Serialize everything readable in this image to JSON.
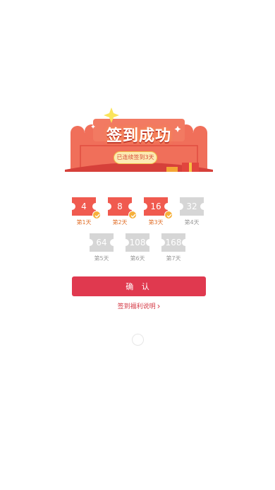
{
  "popup": {
    "title": "签到成功",
    "subtitle": "已连续签到3天",
    "days": [
      {
        "value": "4",
        "label": "第1天",
        "done": true
      },
      {
        "value": "8",
        "label": "第2天",
        "done": true
      },
      {
        "value": "16",
        "label": "第3天",
        "done": true
      },
      {
        "value": "32",
        "label": "第4天",
        "done": false
      },
      {
        "value": "64",
        "label": "第5天",
        "done": false
      },
      {
        "value": "108",
        "label": "第6天",
        "done": false
      },
      {
        "value": "168",
        "label": "第7天",
        "done": false
      }
    ],
    "confirm_label": "确 认",
    "rules_link": "签到福利说明",
    "colors": {
      "ticket_done": "#f05a4f",
      "ticket_todo": "#d6d6d6",
      "check": "#f6b03a",
      "button": "#e0394f",
      "banner": "#f06f5a"
    }
  }
}
